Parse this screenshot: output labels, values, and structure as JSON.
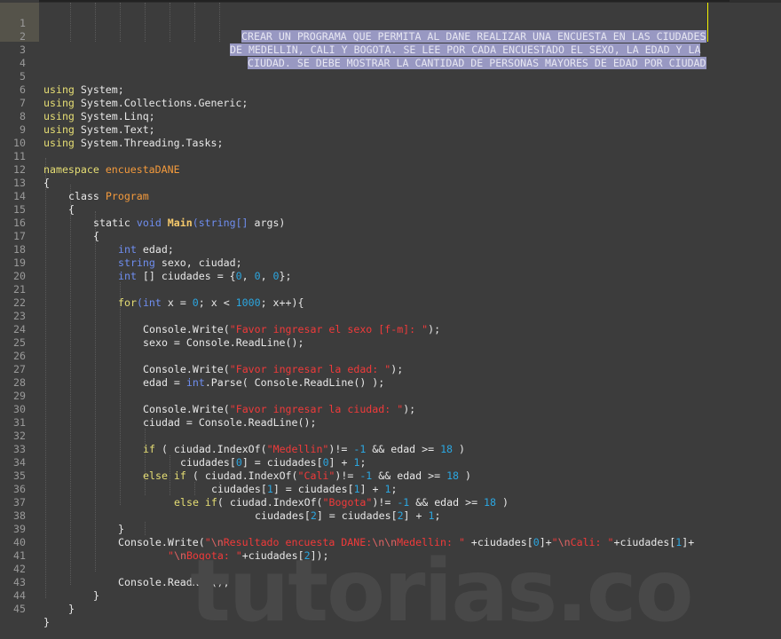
{
  "editor": {
    "language": "csharp",
    "colors": {
      "background": "#3c3c3c",
      "keyword": "#e6de74",
      "type": "#6f8ef0",
      "class_name": "#f39a3c",
      "method": "#f5c96b",
      "number": "#2ba6e0",
      "string": "#f03a3a",
      "selection": "#9898c2",
      "caret": "#f2f200"
    },
    "selected_lines": [
      1,
      2,
      3
    ],
    "lines": [
      {
        "n": "1",
        "text": "CREAR UN PROGRAMA QUE PERMITA AL DANE REALIZAR UNA ENCUESTA EN LAS CIUDADES"
      },
      {
        "n": "2",
        "text": "DE MEDELLIN, CALI Y BOGOTA. SE LEE POR CADA ENCUESTADO EL SEXO, LA EDAD Y LA"
      },
      {
        "n": "3",
        "text": "CIUDAD. SE DEBE MOSTRAR LA CANTIDAD DE PERSONAS MAYORES DE EDAD POR CIUDAD"
      },
      {
        "n": "4",
        "text": ""
      },
      {
        "n": "5",
        "text": "using System;"
      },
      {
        "n": "6",
        "text": "using System.Collections.Generic;"
      },
      {
        "n": "7",
        "text": "using System.Linq;"
      },
      {
        "n": "8",
        "text": "using System.Text;"
      },
      {
        "n": "9",
        "text": "using System.Threading.Tasks;"
      },
      {
        "n": "10",
        "text": ""
      },
      {
        "n": "11",
        "text": "namespace encuestaDANE"
      },
      {
        "n": "12",
        "text": "{"
      },
      {
        "n": "13",
        "text": "class Program"
      },
      {
        "n": "14",
        "text": "{"
      },
      {
        "n": "15",
        "text": "static void Main(string[] args)"
      },
      {
        "n": "16",
        "text": "{"
      },
      {
        "n": "17",
        "text": "int edad;"
      },
      {
        "n": "18",
        "text": "string sexo, ciudad;"
      },
      {
        "n": "19",
        "text": "int [] ciudades = {0, 0, 0};"
      },
      {
        "n": "20",
        "text": ""
      },
      {
        "n": "21",
        "text": "for(int x = 0; x < 1000; x++){"
      },
      {
        "n": "22",
        "text": ""
      },
      {
        "n": "23",
        "text": "Console.Write(\"Favor ingresar el sexo [f-m]: \");"
      },
      {
        "n": "24",
        "text": "sexo = Console.ReadLine();"
      },
      {
        "n": "25",
        "text": ""
      },
      {
        "n": "26",
        "text": "Console.Write(\"Favor ingresar la edad: \");"
      },
      {
        "n": "27",
        "text": "edad = int.Parse( Console.ReadLine() );"
      },
      {
        "n": "28",
        "text": ""
      },
      {
        "n": "29",
        "text": "Console.Write(\"Favor ingresar la ciudad: \");"
      },
      {
        "n": "30",
        "text": "ciudad = Console.ReadLine();"
      },
      {
        "n": "31",
        "text": ""
      },
      {
        "n": "32",
        "text": "if ( ciudad.IndexOf(\"Medellin\")!= -1 && edad >= 18 )"
      },
      {
        "n": "33",
        "text": "ciudades[0] = ciudades[0] + 1;"
      },
      {
        "n": "34",
        "text": "else if ( ciudad.IndexOf(\"Cali\")!= -1 && edad >= 18 )"
      },
      {
        "n": "35",
        "text": "ciudades[1] = ciudades[1] + 1;"
      },
      {
        "n": "36",
        "text": "else if( ciudad.IndexOf(\"Bogota\")!= -1 && edad >= 18 )"
      },
      {
        "n": "37",
        "text": "ciudades[2] = ciudades[2] + 1;"
      },
      {
        "n": "38",
        "text": "}"
      },
      {
        "n": "39",
        "text": "Console.Write(\"\\nResultado encuesta DANE:\\n\\nMedellin: \" +ciudades[0]+\"\\nCali: \"+ciudades[1]+"
      },
      {
        "n": "40",
        "text": "\"\\nBogota: \"+ciudades[2]);"
      },
      {
        "n": "41",
        "text": ""
      },
      {
        "n": "42",
        "text": "Console.ReadKey();"
      },
      {
        "n": "43",
        "text": "}"
      },
      {
        "n": "44",
        "text": "}"
      },
      {
        "n": "45",
        "text": "}"
      }
    ]
  },
  "tokens": {
    "using": "using",
    "System": "System;",
    "Collections": "System.Collections.Generic;",
    "Linq": "System.Linq;",
    "Text": "System.Text;",
    "Tasks": "System.Threading.Tasks;",
    "namespace": "namespace",
    "ns_name": "encuestaDANE",
    "class": "class",
    "class_name": "Program",
    "static": "static",
    "void": "void",
    "main": "Main",
    "string_arr": "string[]",
    "args": " args)",
    "int": "int",
    "string": "string",
    "for": "for",
    "else": "else",
    "if": "if",
    "zero": "0",
    "one": "1",
    "two": "2",
    "neg_one": "-1",
    "eighteen": "18",
    "thousand": "1000",
    "str_sexo": "\"Favor ingresar el sexo [f-m]: \"",
    "str_edad": "\"Favor ingresar la edad: \"",
    "str_ciudad": "\"Favor ingresar la ciudad: \"",
    "str_medellin": "\"Medellin\"",
    "str_cali": "\"Cali\"",
    "str_bogota": "\"Bogota\"",
    "console_write": "Console.Write(",
    "res_q1": "\"",
    "res_e1": "\\n",
    "res_t1": "Resultado encuesta DANE:",
    "res_e2": "\\n\\n",
    "res_t2": "Medellin: \"",
    "res_q2": "\"",
    "res_e3": "\\n",
    "res_t3": "Cali: \"",
    "res_e4": "\\n",
    "res_t4": "Bogota: \""
  },
  "watermark": {
    "text": "tutorias.co"
  }
}
